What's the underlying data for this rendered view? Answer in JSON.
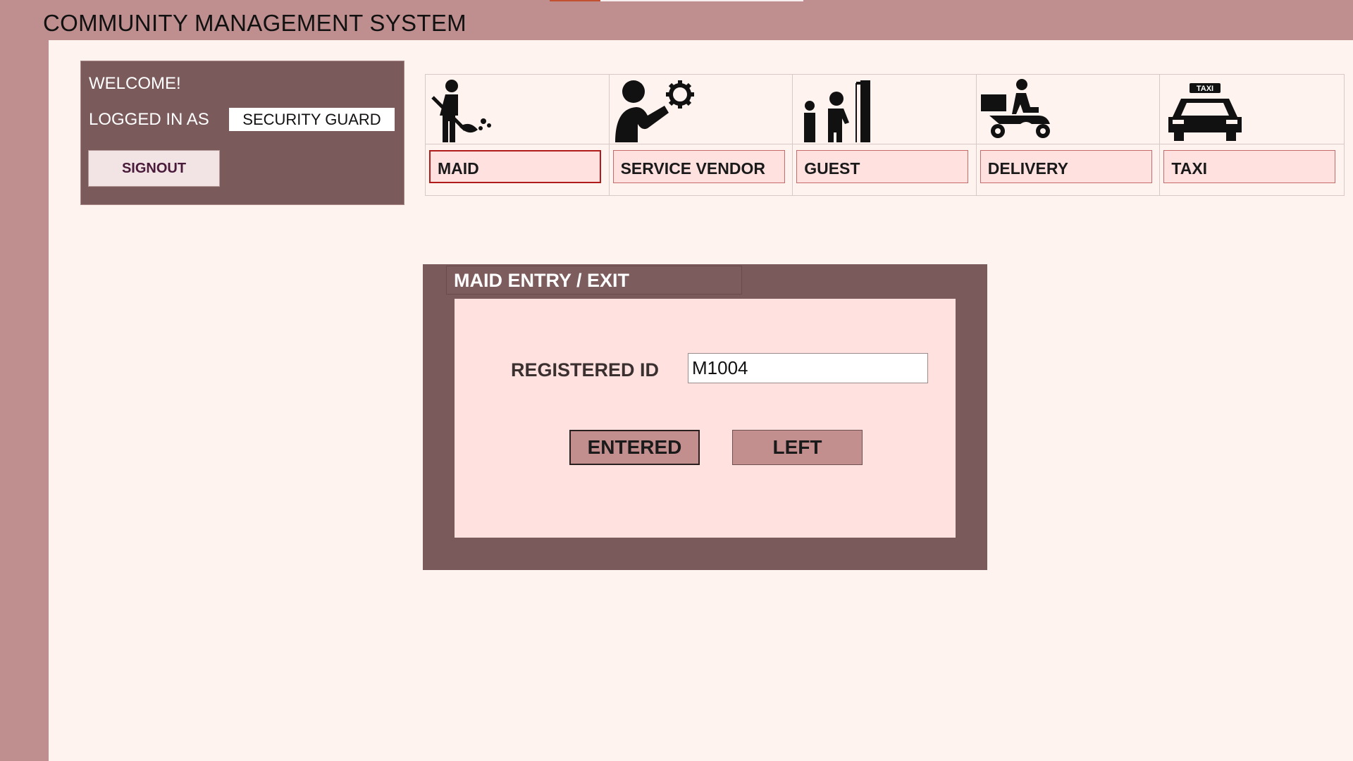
{
  "app": {
    "title": "COMMUNITY MANAGEMENT SYSTEM"
  },
  "welcome": {
    "greeting": "WELCOME!",
    "logged_in_label": "LOGGED IN AS",
    "role": "SECURITY GUARD",
    "signout_label": "SIGNOUT"
  },
  "categories": [
    {
      "label": "MAID",
      "icon": "maid-icon",
      "active": true
    },
    {
      "label": "SERVICE VENDOR",
      "icon": "service-vendor-icon",
      "active": false
    },
    {
      "label": "GUEST",
      "icon": "guest-icon",
      "active": false
    },
    {
      "label": "DELIVERY",
      "icon": "delivery-icon",
      "active": false
    },
    {
      "label": "TAXI",
      "icon": "taxi-icon",
      "active": false
    }
  ],
  "icon_text": {
    "taxi_sign": "TAXI"
  },
  "entry_panel": {
    "title": "MAID ENTRY / EXIT",
    "registered_id_label": "REGISTERED ID",
    "registered_id_value": "M1004",
    "entered_label": "ENTERED",
    "left_label": "LEFT"
  },
  "colors": {
    "background": "#bf8f8f",
    "content": "#fff3ef",
    "panel": "#7b5a5b",
    "button_pink": "#ffe1df",
    "active_border": "#b01b1b",
    "action_button": "#c38e8e"
  }
}
